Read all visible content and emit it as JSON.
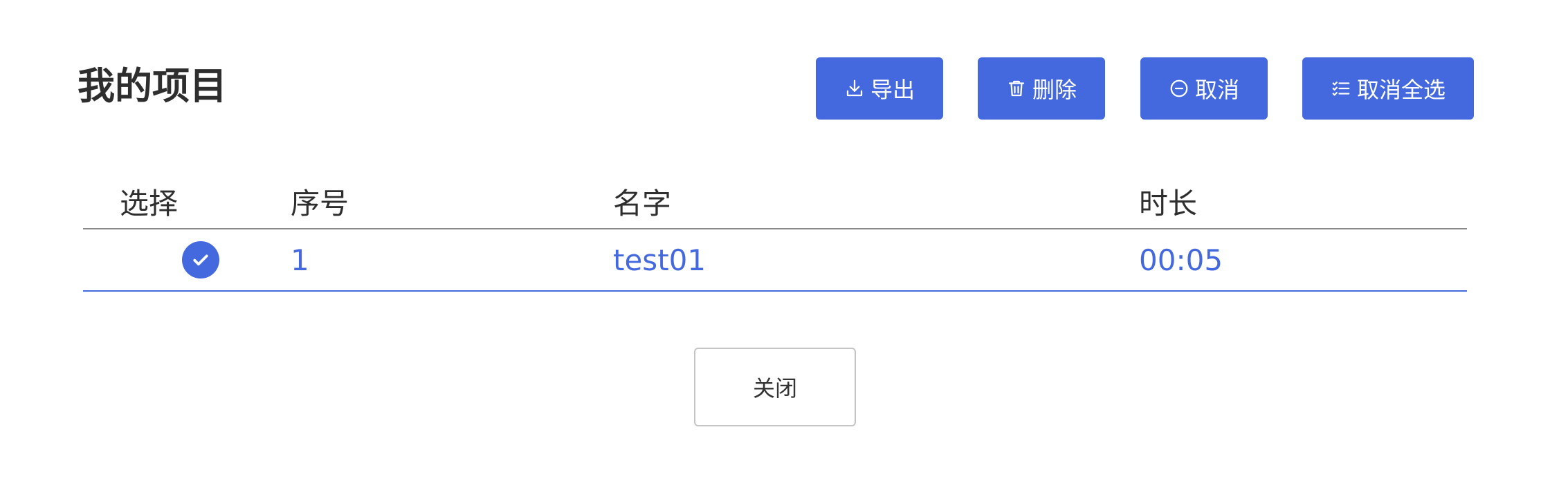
{
  "page": {
    "title": "我的项目"
  },
  "toolbar": {
    "export_label": "导出",
    "delete_label": "删除",
    "cancel_label": "取消",
    "deselect_all_label": "取消全选"
  },
  "table": {
    "headers": {
      "select": "选择",
      "index": "序号",
      "name": "名字",
      "duration": "时长"
    },
    "rows": [
      {
        "selected": true,
        "index": "1",
        "name": "test01",
        "duration": "00:05"
      }
    ]
  },
  "footer": {
    "close_label": "关闭"
  },
  "colors": {
    "accent": "#4469df",
    "text": "#333333"
  },
  "icons": {
    "export": "download-icon",
    "delete": "trash-icon",
    "cancel": "minus-circle-icon",
    "deselect_all": "checklist-icon",
    "row_selected": "check-circle-icon"
  }
}
